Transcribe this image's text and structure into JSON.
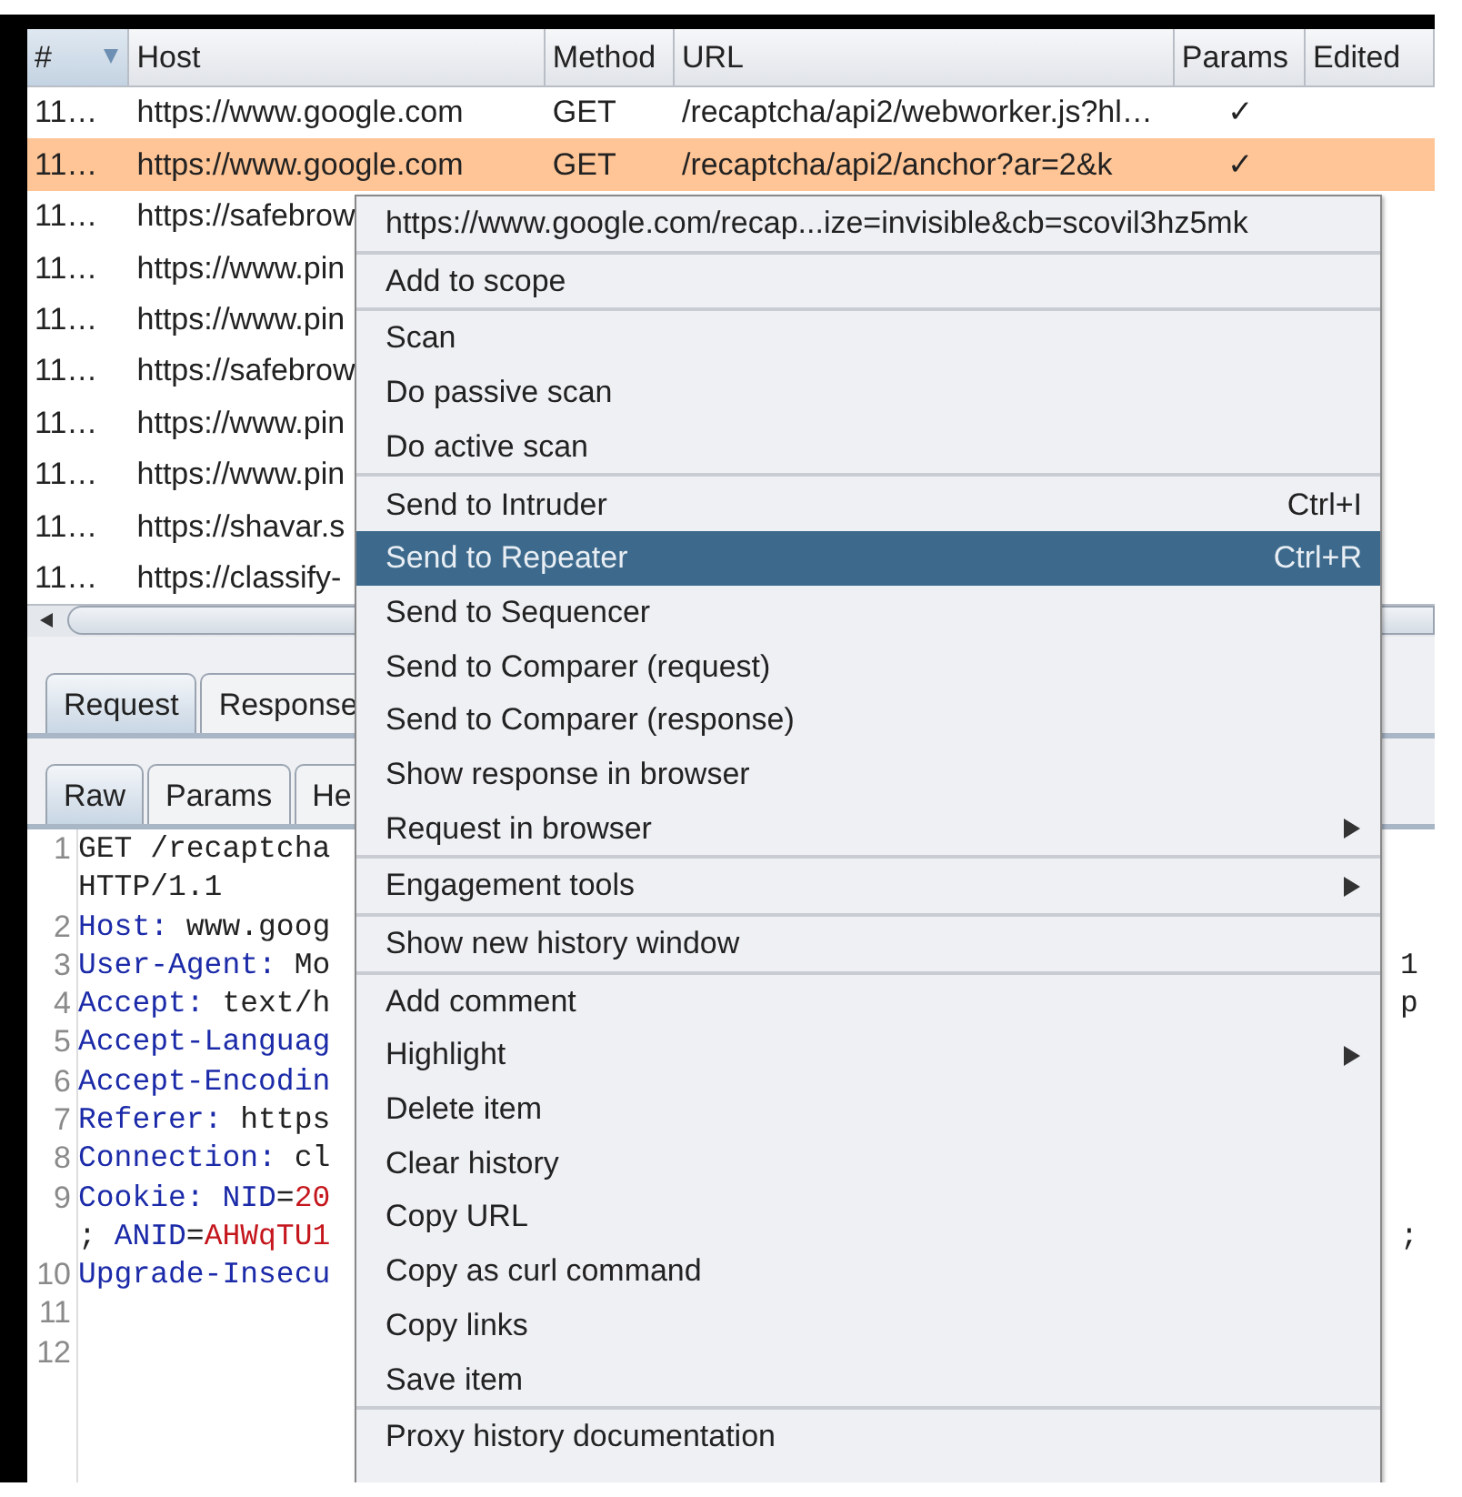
{
  "table": {
    "columns": [
      {
        "label": "#",
        "sorted": true
      },
      {
        "label": "Host",
        "sorted": false
      },
      {
        "label": "Method",
        "sorted": false
      },
      {
        "label": "URL",
        "sorted": false
      },
      {
        "label": "Params",
        "sorted": false
      },
      {
        "label": "Edited",
        "sorted": false
      }
    ],
    "rows": [
      {
        "number": "11…",
        "host": "https://www.google.com",
        "method": "GET",
        "url": "/recaptcha/api2/webworker.js?hl…",
        "params": "✓",
        "selected": false
      },
      {
        "number": "11…",
        "host": "https://www.google.com",
        "method": "GET",
        "url": "/recaptcha/api2/anchor?ar=2&k",
        "params": "✓",
        "selected": true
      },
      {
        "number": "11…",
        "host": "https://safebrow",
        "selected": false
      },
      {
        "number": "11…",
        "host": "https://www.pin",
        "selected": false
      },
      {
        "number": "11…",
        "host": "https://www.pin",
        "selected": false
      },
      {
        "number": "11…",
        "host": "https://safebrow",
        "selected": false
      },
      {
        "number": "11…",
        "host": "https://www.pin",
        "selected": false
      },
      {
        "number": "11…",
        "host": "https://www.pin",
        "selected": false
      },
      {
        "number": "11…",
        "host": "https://shavar.s",
        "selected": false
      },
      {
        "number": "11…",
        "host": "https://classify-",
        "selected": false
      }
    ]
  },
  "tabs": [
    {
      "label": "Request",
      "selected": true
    },
    {
      "label": "Response",
      "selected": false
    }
  ],
  "subtabs": [
    {
      "label": "Raw",
      "selected": true
    },
    {
      "label": "Params",
      "selected": false
    },
    {
      "label": "He",
      "selected": false
    }
  ],
  "editor": {
    "lines": [
      {
        "number": "1",
        "segments": [
          {
            "kind": "plain",
            "text": "GET /recaptcha"
          }
        ]
      },
      {
        "segments": [
          {
            "kind": "plain",
            "text": "HTTP/1.1"
          }
        ]
      },
      {
        "number": "2",
        "segments": [
          {
            "kind": "key",
            "text": "Host:"
          },
          {
            "kind": "plain",
            "text": " www.goog"
          }
        ]
      },
      {
        "number": "3",
        "segments": [
          {
            "kind": "key",
            "text": "User-Agent:"
          },
          {
            "kind": "plain",
            "text": " Mo"
          }
        ],
        "tail": "1"
      },
      {
        "number": "4",
        "segments": [
          {
            "kind": "key",
            "text": "Accept:"
          },
          {
            "kind": "plain",
            "text": " text/h"
          }
        ],
        "tail": "p"
      },
      {
        "number": "5",
        "segments": [
          {
            "kind": "key",
            "text": "Accept-Languag"
          }
        ]
      },
      {
        "number": "6",
        "segments": [
          {
            "kind": "key",
            "text": "Accept-Encodin"
          }
        ]
      },
      {
        "number": "7",
        "segments": [
          {
            "kind": "key",
            "text": "Referer:"
          },
          {
            "kind": "plain",
            "text": " https"
          }
        ]
      },
      {
        "number": "8",
        "segments": [
          {
            "kind": "key",
            "text": "Connection:"
          },
          {
            "kind": "plain",
            "text": " cl"
          }
        ]
      },
      {
        "number": "9",
        "segments": [
          {
            "kind": "key",
            "text": "Cookie:"
          },
          {
            "kind": "name",
            "text": " NID"
          },
          {
            "kind": "plain",
            "text": "="
          },
          {
            "kind": "value",
            "text": "20"
          }
        ]
      },
      {
        "segments": [
          {
            "kind": "plain",
            "text": "; "
          },
          {
            "kind": "name",
            "text": "ANID"
          },
          {
            "kind": "plain",
            "text": "="
          },
          {
            "kind": "value",
            "text": "AHWqTU1"
          }
        ],
        "tail": ";"
      },
      {
        "number": "10",
        "segments": [
          {
            "kind": "key",
            "text": "Upgrade-Insecu"
          }
        ]
      },
      {
        "number": "11"
      },
      {
        "number": "12"
      }
    ]
  },
  "context_menu": {
    "groups": [
      [
        {
          "label": "https://www.google.com/recap...ize=invisible&cb=scovil3hz5mk",
          "selected": false
        }
      ],
      [
        {
          "label": "Add to scope",
          "selected": false
        }
      ],
      [
        {
          "label": "Scan",
          "selected": false
        },
        {
          "label": "Do passive scan",
          "selected": false
        },
        {
          "label": "Do active scan",
          "selected": false
        }
      ],
      [
        {
          "label": "Send to Intruder",
          "shortcut": "Ctrl+I",
          "selected": false
        },
        {
          "label": "Send to Repeater",
          "shortcut": "Ctrl+R",
          "selected": true
        },
        {
          "label": "Send to Sequencer",
          "selected": false
        },
        {
          "label": "Send to Comparer (request)",
          "selected": false
        },
        {
          "label": "Send to Comparer (response)",
          "selected": false
        },
        {
          "label": "Show response in browser",
          "selected": false
        },
        {
          "label": "Request in browser",
          "submenu": true,
          "selected": false
        }
      ],
      [
        {
          "label": "Engagement tools",
          "submenu": true,
          "selected": false
        }
      ],
      [
        {
          "label": "Show new history window",
          "selected": false
        }
      ],
      [
        {
          "label": "Add comment",
          "selected": false
        },
        {
          "label": "Highlight",
          "submenu": true,
          "selected": false
        },
        {
          "label": "Delete item",
          "selected": false
        },
        {
          "label": "Clear history",
          "selected": false
        },
        {
          "label": "Copy URL",
          "selected": false
        },
        {
          "label": "Copy as curl command",
          "selected": false
        },
        {
          "label": "Copy links",
          "selected": false
        },
        {
          "label": "Save item",
          "selected": false
        }
      ],
      [
        {
          "label": "Proxy history documentation",
          "selected": false
        }
      ]
    ]
  }
}
